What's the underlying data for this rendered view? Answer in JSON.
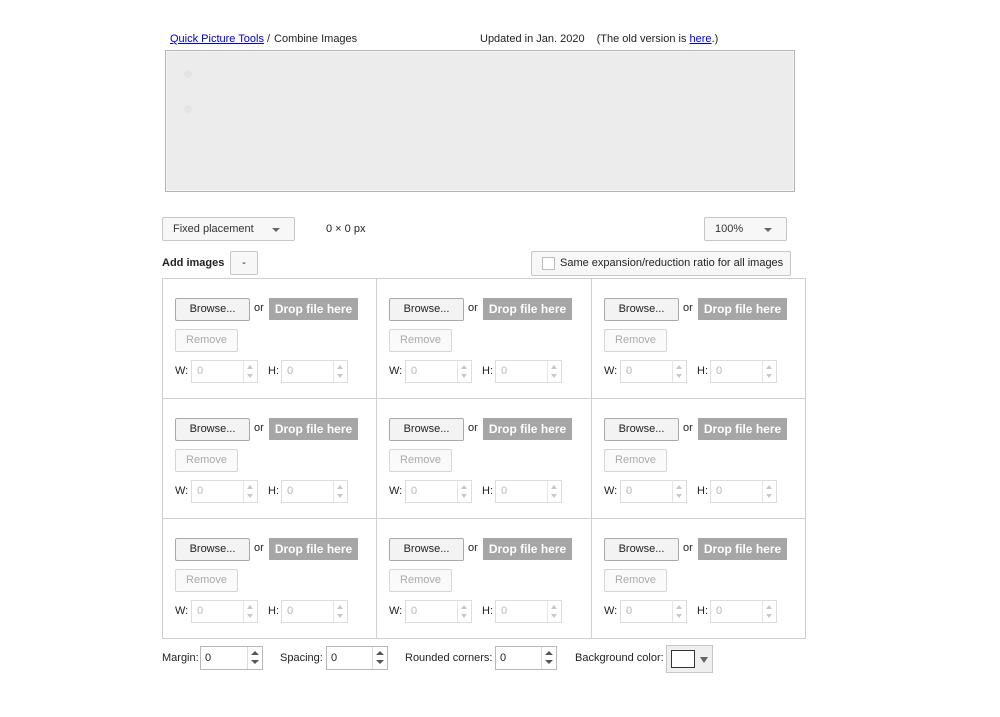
{
  "header": {
    "breadcrumb_link": "Quick Picture Tools",
    "breadcrumb_sep": "/",
    "breadcrumb_current": "Combine Images",
    "updated": "Updated in Jan. 2020",
    "old_version_prefix": "(The old version is ",
    "old_version_link": "here",
    "old_version_suffix": ".)"
  },
  "controls": {
    "placement": "Fixed placement",
    "dimensions": "0 × 0 px",
    "zoom": "100%",
    "add_images": "Add images",
    "minus": "-",
    "same_ratio": "Same expansion/reduction ratio for all images",
    "same_ratio_checked": false
  },
  "slot_labels": {
    "browse": "Browse...",
    "or": "or",
    "drop": "Drop file here",
    "remove": "Remove",
    "w": "W:",
    "h": "H:"
  },
  "slots": [
    {
      "w": "0",
      "h": "0"
    },
    {
      "w": "0",
      "h": "0"
    },
    {
      "w": "0",
      "h": "0"
    },
    {
      "w": "0",
      "h": "0"
    },
    {
      "w": "0",
      "h": "0"
    },
    {
      "w": "0",
      "h": "0"
    },
    {
      "w": "0",
      "h": "0"
    },
    {
      "w": "0",
      "h": "0"
    },
    {
      "w": "0",
      "h": "0"
    }
  ],
  "settings": {
    "margin_label": "Margin:",
    "margin": "0",
    "spacing_label": "Spacing:",
    "spacing": "0",
    "rounded_label": "Rounded corners:",
    "rounded": "0",
    "bg_label": "Background color:",
    "bg_color": "#ffffff"
  }
}
